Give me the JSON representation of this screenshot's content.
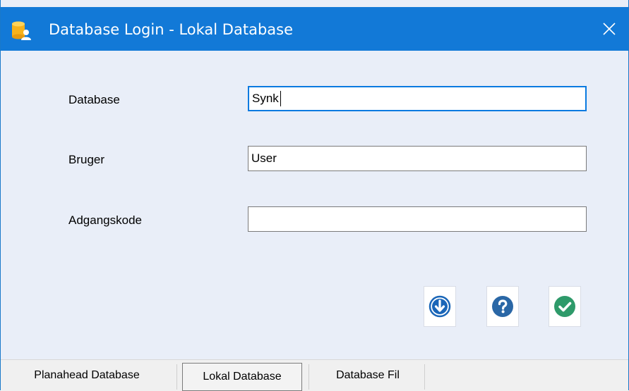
{
  "window": {
    "title": "Database Login - Lokal Database",
    "icon": "database-user-icon",
    "close_icon": "close-icon"
  },
  "form": {
    "database": {
      "label": "Database",
      "value": "Synk"
    },
    "user": {
      "label": "Bruger",
      "value": "User"
    },
    "password": {
      "label": "Adgangskode",
      "value": ""
    }
  },
  "actions": [
    {
      "name": "download",
      "icon": "arrow-down-circle-icon",
      "color": "#1a66b8"
    },
    {
      "name": "help",
      "icon": "question-circle-icon",
      "color": "#2a67a6"
    },
    {
      "name": "ok",
      "icon": "check-circle-icon",
      "color": "#2e9a6a"
    }
  ],
  "tabs": [
    {
      "label": "Planahead Database",
      "selected": false
    },
    {
      "label": "Lokal Database",
      "selected": true
    },
    {
      "label": "Database Fil",
      "selected": false
    }
  ],
  "colors": {
    "titlebar": "#1279d7",
    "background": "#e9eef8",
    "focus_border": "#0a7ae0"
  }
}
